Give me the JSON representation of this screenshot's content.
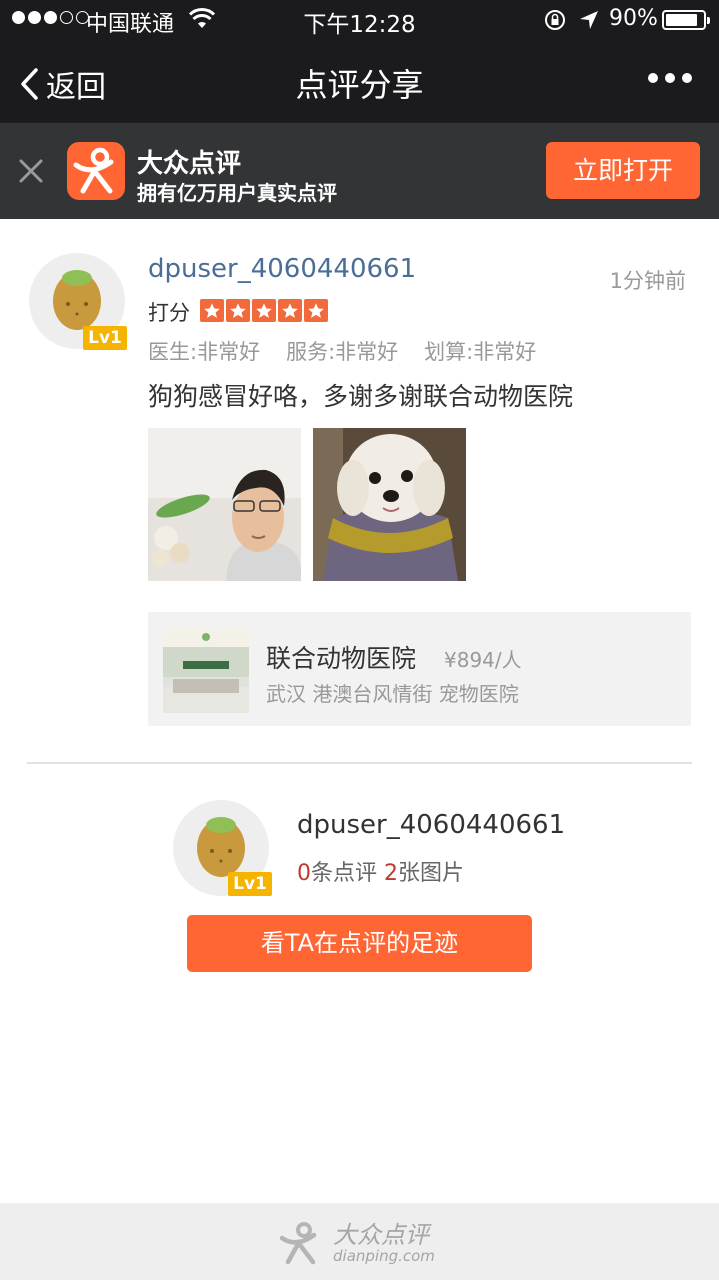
{
  "status_bar": {
    "carrier": "中国联通",
    "time": "下午12:28",
    "battery_percent": "90%",
    "battery_level": 0.9,
    "signal_bars_filled": 3,
    "signal_bars_total": 5
  },
  "nav": {
    "back_label": "返回",
    "title": "点评分享"
  },
  "banner": {
    "app_name": "大众点评",
    "app_tagline": "拥有亿万用户真实点评",
    "open_button": "立即打开",
    "brand_color": "#ff6633"
  },
  "review": {
    "username": "dpuser_4060440661",
    "level": "Lv1",
    "time_ago": "1分钟前",
    "score_label": "打分",
    "stars": 5,
    "sub_scores": [
      "医生:非常好",
      "服务:非常好",
      "划算:非常好"
    ],
    "text": "狗狗感冒好咯，多谢多谢联合动物医院",
    "photos": [
      "selfie-photo",
      "dog-photo"
    ]
  },
  "shop": {
    "name": "联合动物医院",
    "price": "¥894/人",
    "meta": "武汉 港澳台风情街 宠物医院"
  },
  "profile": {
    "username": "dpuser_4060440661",
    "level": "Lv1",
    "review_count": "0",
    "review_suffix": "条点评 ",
    "photo_count": "2",
    "photo_suffix": "张图片",
    "track_button": "看TA在点评的足迹"
  },
  "footer": {
    "brand": "大众点评",
    "url": "dianping.com"
  }
}
